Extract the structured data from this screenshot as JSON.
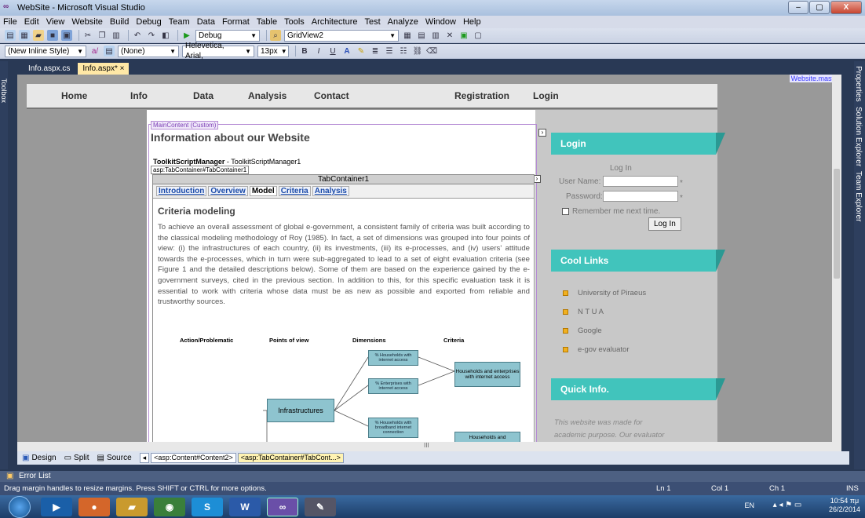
{
  "window": {
    "title": "WebSite - Microsoft Visual Studio",
    "min": "–",
    "max": "▢",
    "close": "X"
  },
  "menu": [
    "File",
    "Edit",
    "View",
    "Website",
    "Build",
    "Debug",
    "Team",
    "Data",
    "Format",
    "Table",
    "Tools",
    "Architecture",
    "Test",
    "Analyze",
    "Window",
    "Help"
  ],
  "toolbar1": {
    "config": "Debug",
    "object": "GridView2"
  },
  "toolbar2": {
    "style": "(New Inline Style)",
    "target": "(None)",
    "font": "Helevetica, Arial, ",
    "size": "13px",
    "bold": "B",
    "italic": "I",
    "underline": "U"
  },
  "left_toolbox": "Toolbox",
  "doc_tabs": [
    {
      "label": "Info.aspx.cs"
    },
    {
      "label": "Info.aspx*",
      "close": "×"
    }
  ],
  "right_dock": [
    "Properties",
    "Solution Explorer",
    "Team Explorer"
  ],
  "master_tag": "Website.master",
  "nav": [
    "Home",
    "Info",
    "Data",
    "Analysis",
    "Contact",
    "Registration",
    "Login"
  ],
  "main_content_tag": "MainContent (Custom)",
  "page_heading": "Information about our Website",
  "toolkit": {
    "bold": "ToolkitScriptManager",
    "rest": " - ToolkitScriptManager1"
  },
  "tabcontainer_tag": "asp:TabContainer#TabContainer1",
  "tabcontainer_title": "TabContainer1",
  "tabs": [
    "Introduction",
    "Overview",
    "Model",
    "Criteria",
    "Analysis"
  ],
  "active_tab": "Model",
  "section_heading": "Criteria modeling",
  "paragraph": "To achieve an overall assessment of global e-government, a consistent family of criteria was built according to the classical modeling methodology of Roy (1985). In fact, a set of dimensions was grouped into four points of view: (i) the infrastructures of each country, (ii) its investments, (iii) its e-processes, and (iv) users' attitude towards the e-processes, which in turn were sub-aggregated to lead to a set of eight evaluation criteria (see Figure 1 and the detailed descriptions below). Some of them are based on the experience gained by the e-government surveys, cited in the previous section. In addition to this, for this specific evaluation task it is essential to work with criteria whose data must be as new as possible and exported from reliable and trustworthy sources.",
  "diagram": {
    "headers": [
      "Action/Problematic",
      "Points of view",
      "Dimensions",
      "Criteria"
    ],
    "point_of_view": "Infrastructures",
    "dimensions": [
      "% Households with internet access",
      "% Enterprises with internet access",
      "% Households with broadband internet connection"
    ],
    "criteria": [
      "Households and enterprises with internet access",
      "Households and"
    ]
  },
  "login": {
    "title": "Login",
    "subtitle": "Log In",
    "user_label": "User Name:",
    "pass_label": "Password:",
    "remember": "Remember me next time.",
    "button": "Log In",
    "req1": "*",
    "req2": "*"
  },
  "cool_links": {
    "title": "Cool Links",
    "items": [
      "University of Piraeus",
      "N T U A",
      "Google",
      "e-gov evaluator"
    ]
  },
  "quick_info": {
    "title": "Quick Info.",
    "text1": "This website was made for",
    "text2": "academic purpose. Our evaluator"
  },
  "hscroll_mark": "III",
  "views": {
    "design": "Design",
    "split": "Split",
    "source": "Source"
  },
  "breadcrumbs": [
    "<asp:Content#Content2>",
    "<asp:TabContainer#TabCont...>"
  ],
  "error_list": "Error List",
  "status": {
    "msg": "Drag margin handles to resize margins. Press SHIFT or CTRL for more options.",
    "ln": "Ln 1",
    "col": "Col 1",
    "ch": "Ch 1",
    "ins": "INS"
  },
  "tray": {
    "lang": "EN",
    "time": "10:54 πμ",
    "date": "26/2/2014"
  }
}
